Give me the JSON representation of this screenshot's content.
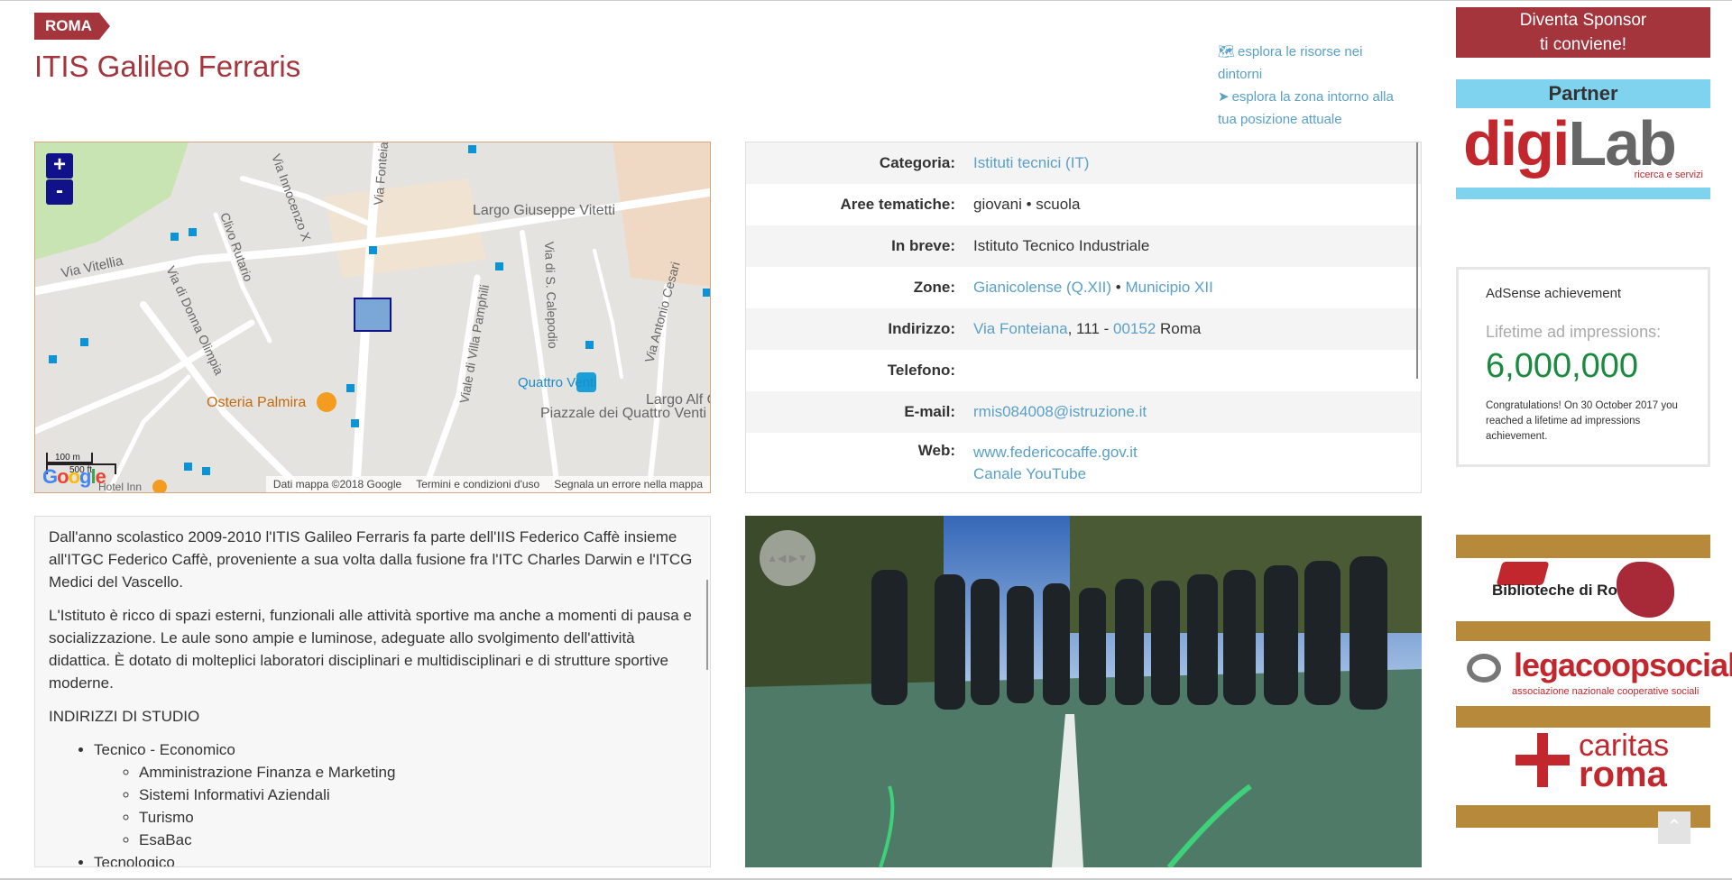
{
  "header": {
    "city": "ROMA",
    "title": "ITIS Galileo Ferraris"
  },
  "explore": {
    "resources_link": "esplora le risorse nei dintorni",
    "zone_link": "esplora la zona intorno alla tua posizione attuale"
  },
  "map": {
    "zoom_in": "+",
    "zoom_out": "-",
    "labels": {
      "via_innocenzo": "Via Innocenzo X",
      "via_fonteiana": "Via Fonteiana",
      "largo_vitetti": "Largo Giuseppe Vitetti",
      "via_vitellia": "Via Vitellia",
      "clivo_rutario": "Clivo Rutario",
      "via_donna_olimpia": "Via di Donna Olimpia",
      "via_calepodio": "Via di S. Calepodio",
      "viale_pamphili": "Viale di Villa Pamphili",
      "via_cesari": "Via Antonio Cesari",
      "osteria": "Osteria Palmira",
      "quattro_venti": "Quattro Venti",
      "piazzale": "Piazzale dei Quattro Venti",
      "largo_alf": "Largo Alf Orian",
      "hotel_inn": "Hotel Inn"
    },
    "scale_m": "100 m",
    "scale_ft": "500 ft",
    "footer": {
      "data": "Dati mappa ©2018 Google",
      "terms": "Termini e condizioni d'uso",
      "report": "Segnala un errore nella mappa"
    }
  },
  "info": {
    "categoria_label": "Categoria:",
    "categoria_value": "Istituti tecnici (IT)",
    "aree_label": "Aree tematiche:",
    "aree_value": "giovani • scuola",
    "breve_label": "In breve:",
    "breve_value": "Istituto Tecnico Industriale",
    "zone_label": "Zone:",
    "zone_value1": "Gianicolense (Q.XII)",
    "zone_sep": " • ",
    "zone_value2": "Municipio XII",
    "indirizzo_label": "Indirizzo:",
    "indirizzo_street": "Via Fonteiana",
    "indirizzo_num": ", 111 - ",
    "indirizzo_cap": "00152",
    "indirizzo_city": " Roma",
    "telefono_label": "Telefono:",
    "telefono_value": "",
    "email_label": "E-mail:",
    "email_value": "rmis084008@istruzione.it",
    "web_label": "Web:",
    "web_value": "www.federicocaffe.gov.it",
    "web_value2": "Canale YouTube"
  },
  "description": {
    "p1": "Dall'anno scolastico 2009-2010 l'ITIS Galileo Ferraris fa parte dell'IIS Federico Caffè insieme all'ITGC Federico Caffè, proveniente a sua volta dalla fusione fra l'ITC Charles Darwin e l'ITCG Medici del Vascello.",
    "p2": "L'Istituto è ricco di spazi esterni, funzionali alle attività sportive ma anche a momenti di pausa e socializzazione. Le aule sono ampie e luminose, adeguate allo svolgimento dell'attività didattica. È dotato di molteplici laboratori disciplinari e multidisciplinari e di strutture sportive moderne.",
    "heading": "INDIRIZZI DI STUDIO",
    "track1": "Tecnico - Economico",
    "sub": [
      "Amministrazione Finanza e Marketing",
      "Sistemi Informativi Aziendali",
      "Turismo",
      "EsaBac"
    ],
    "track2": "Tecnologico"
  },
  "sidebar": {
    "sponsor_line1": "Diventa Sponsor",
    "sponsor_line2": "ti conviene!",
    "partner_title": "Partner",
    "partner_logo_main": "digi",
    "partner_logo_lab": "Lab",
    "partner_logo_sub": "ricerca e servizi",
    "adsense_title": "AdSense achievement",
    "adsense_label": "Lifetime ad impressions:",
    "adsense_value": "6,000,000",
    "adsense_note": "Congratulations! On 30 October 2017 you reached a lifetime ad impressions achievement.",
    "biblio": "Biblioteche di Roma",
    "lega": "legacoopsociali",
    "lega_sub": "associazione nazionale cooperative sociali",
    "caritas_top": "caritas",
    "caritas_bottom": "roma"
  }
}
